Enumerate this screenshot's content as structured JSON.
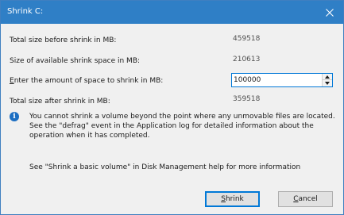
{
  "window": {
    "title": "Shrink C:"
  },
  "rows": {
    "total_before": {
      "label": "Total size before shrink in MB:",
      "value": "459518"
    },
    "available": {
      "label": "Size of available shrink space in MB:",
      "value": "210613"
    },
    "amount": {
      "label_access_key": "E",
      "label_rest": "nter the amount of space to shrink in MB:",
      "value": "100000"
    },
    "total_after": {
      "label": "Total size after shrink in MB:",
      "value": "359518"
    }
  },
  "info": {
    "icon": "info-icon",
    "text": "You cannot shrink a volume beyond the point where any unmovable files are located. See the \"defrag\" event in the Application log for detailed information about the operation when it has completed."
  },
  "help": {
    "text": "See \"Shrink a basic volume\" in Disk Management help for more information"
  },
  "buttons": {
    "shrink_access_key": "S",
    "shrink_rest": "hrink",
    "cancel_access_key": "C",
    "cancel_rest": "ancel"
  },
  "colors": {
    "titlebar": "#2f7fc6",
    "focus_border": "#0078d7",
    "info_icon": "#1c6ec2"
  }
}
